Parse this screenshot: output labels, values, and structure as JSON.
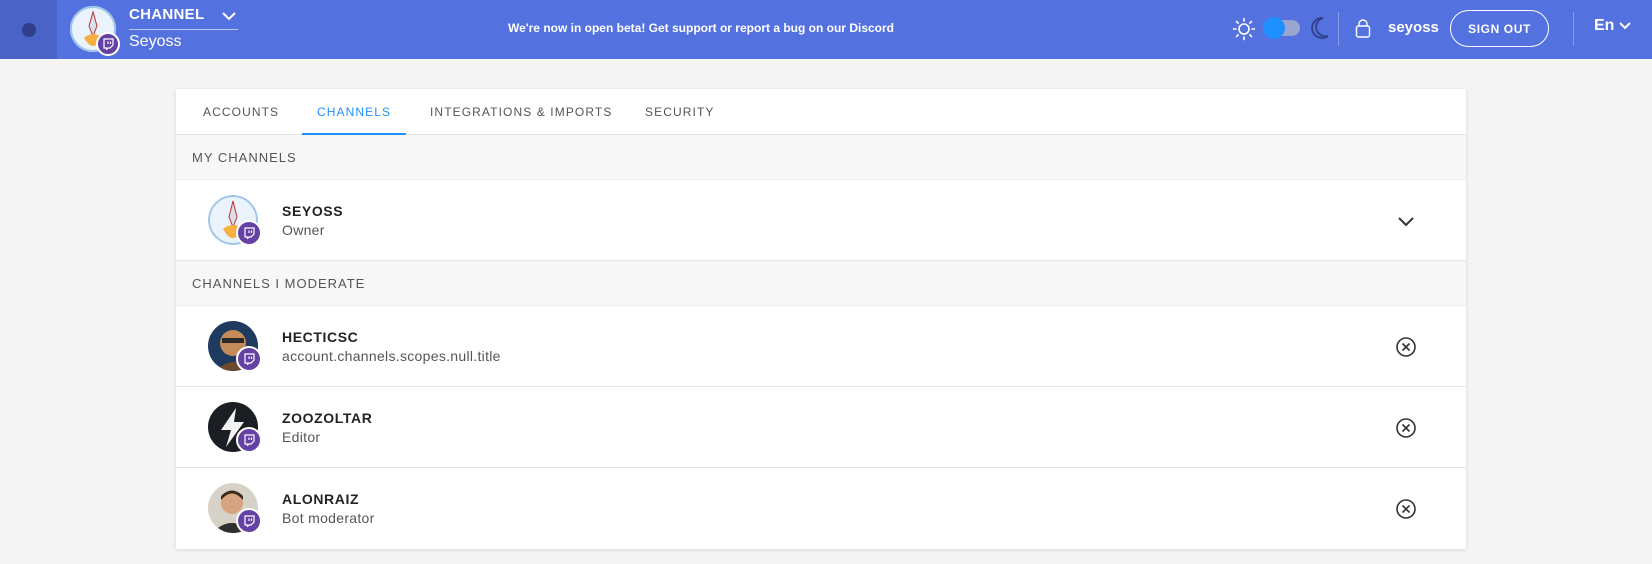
{
  "header": {
    "channel_label": "CHANNEL",
    "channel_name": "Seyoss",
    "beta_text": "We're now in open beta! Get support or report a bug on our ",
    "beta_link": "Discord",
    "username": "seyoss",
    "signout_label": "SIGN OUT",
    "language": "En"
  },
  "tabs": [
    {
      "label": "ACCOUNTS",
      "active": false
    },
    {
      "label": "CHANNELS",
      "active": true
    },
    {
      "label": "INTEGRATIONS & IMPORTS",
      "active": false
    },
    {
      "label": "SECURITY",
      "active": false
    }
  ],
  "sections": {
    "my_channels": {
      "title": "MY CHANNELS",
      "rows": [
        {
          "name": "SEYOSS",
          "role": "Owner",
          "action": "expand"
        }
      ]
    },
    "moderated": {
      "title": "CHANNELS I MODERATE",
      "rows": [
        {
          "name": "HECTICSC",
          "role": "account.channels.scopes.null.title",
          "action": "remove"
        },
        {
          "name": "ZOOZOLTAR",
          "role": "Editor",
          "action": "remove"
        },
        {
          "name": "ALONRAIZ",
          "role": "Bot moderator",
          "action": "remove"
        }
      ]
    }
  },
  "colors": {
    "header_bg": "#5471e0",
    "accent": "#1e90ff",
    "twitch": "#6441a5"
  },
  "icons": [
    "menu-icon",
    "twitch-icon",
    "chevron-down-icon",
    "sun-icon",
    "moon-icon",
    "user-icon",
    "close-circle-icon"
  ]
}
